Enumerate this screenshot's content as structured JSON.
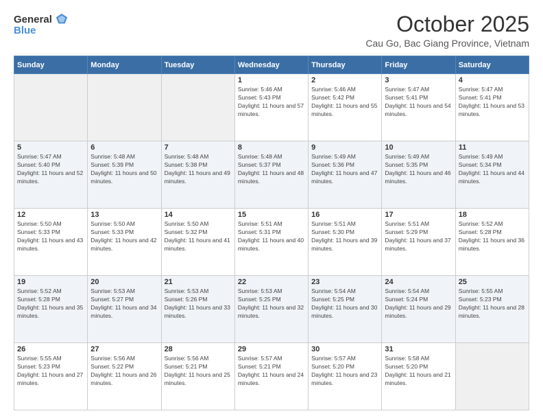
{
  "header": {
    "logo_general": "General",
    "logo_blue": "Blue",
    "month_title": "October 2025",
    "location": "Cau Go, Bac Giang Province, Vietnam"
  },
  "weekdays": [
    "Sunday",
    "Monday",
    "Tuesday",
    "Wednesday",
    "Thursday",
    "Friday",
    "Saturday"
  ],
  "weeks": [
    [
      {
        "day": "",
        "sunrise": "",
        "sunset": "",
        "daylight": ""
      },
      {
        "day": "",
        "sunrise": "",
        "sunset": "",
        "daylight": ""
      },
      {
        "day": "",
        "sunrise": "",
        "sunset": "",
        "daylight": ""
      },
      {
        "day": "1",
        "sunrise": "Sunrise: 5:46 AM",
        "sunset": "Sunset: 5:43 PM",
        "daylight": "Daylight: 11 hours and 57 minutes."
      },
      {
        "day": "2",
        "sunrise": "Sunrise: 5:46 AM",
        "sunset": "Sunset: 5:42 PM",
        "daylight": "Daylight: 11 hours and 55 minutes."
      },
      {
        "day": "3",
        "sunrise": "Sunrise: 5:47 AM",
        "sunset": "Sunset: 5:41 PM",
        "daylight": "Daylight: 11 hours and 54 minutes."
      },
      {
        "day": "4",
        "sunrise": "Sunrise: 5:47 AM",
        "sunset": "Sunset: 5:41 PM",
        "daylight": "Daylight: 11 hours and 53 minutes."
      }
    ],
    [
      {
        "day": "5",
        "sunrise": "Sunrise: 5:47 AM",
        "sunset": "Sunset: 5:40 PM",
        "daylight": "Daylight: 11 hours and 52 minutes."
      },
      {
        "day": "6",
        "sunrise": "Sunrise: 5:48 AM",
        "sunset": "Sunset: 5:39 PM",
        "daylight": "Daylight: 11 hours and 50 minutes."
      },
      {
        "day": "7",
        "sunrise": "Sunrise: 5:48 AM",
        "sunset": "Sunset: 5:38 PM",
        "daylight": "Daylight: 11 hours and 49 minutes."
      },
      {
        "day": "8",
        "sunrise": "Sunrise: 5:48 AM",
        "sunset": "Sunset: 5:37 PM",
        "daylight": "Daylight: 11 hours and 48 minutes."
      },
      {
        "day": "9",
        "sunrise": "Sunrise: 5:49 AM",
        "sunset": "Sunset: 5:36 PM",
        "daylight": "Daylight: 11 hours and 47 minutes."
      },
      {
        "day": "10",
        "sunrise": "Sunrise: 5:49 AM",
        "sunset": "Sunset: 5:35 PM",
        "daylight": "Daylight: 11 hours and 46 minutes."
      },
      {
        "day": "11",
        "sunrise": "Sunrise: 5:49 AM",
        "sunset": "Sunset: 5:34 PM",
        "daylight": "Daylight: 11 hours and 44 minutes."
      }
    ],
    [
      {
        "day": "12",
        "sunrise": "Sunrise: 5:50 AM",
        "sunset": "Sunset: 5:33 PM",
        "daylight": "Daylight: 11 hours and 43 minutes."
      },
      {
        "day": "13",
        "sunrise": "Sunrise: 5:50 AM",
        "sunset": "Sunset: 5:33 PM",
        "daylight": "Daylight: 11 hours and 42 minutes."
      },
      {
        "day": "14",
        "sunrise": "Sunrise: 5:50 AM",
        "sunset": "Sunset: 5:32 PM",
        "daylight": "Daylight: 11 hours and 41 minutes."
      },
      {
        "day": "15",
        "sunrise": "Sunrise: 5:51 AM",
        "sunset": "Sunset: 5:31 PM",
        "daylight": "Daylight: 11 hours and 40 minutes."
      },
      {
        "day": "16",
        "sunrise": "Sunrise: 5:51 AM",
        "sunset": "Sunset: 5:30 PM",
        "daylight": "Daylight: 11 hours and 39 minutes."
      },
      {
        "day": "17",
        "sunrise": "Sunrise: 5:51 AM",
        "sunset": "Sunset: 5:29 PM",
        "daylight": "Daylight: 11 hours and 37 minutes."
      },
      {
        "day": "18",
        "sunrise": "Sunrise: 5:52 AM",
        "sunset": "Sunset: 5:28 PM",
        "daylight": "Daylight: 11 hours and 36 minutes."
      }
    ],
    [
      {
        "day": "19",
        "sunrise": "Sunrise: 5:52 AM",
        "sunset": "Sunset: 5:28 PM",
        "daylight": "Daylight: 11 hours and 35 minutes."
      },
      {
        "day": "20",
        "sunrise": "Sunrise: 5:53 AM",
        "sunset": "Sunset: 5:27 PM",
        "daylight": "Daylight: 11 hours and 34 minutes."
      },
      {
        "day": "21",
        "sunrise": "Sunrise: 5:53 AM",
        "sunset": "Sunset: 5:26 PM",
        "daylight": "Daylight: 11 hours and 33 minutes."
      },
      {
        "day": "22",
        "sunrise": "Sunrise: 5:53 AM",
        "sunset": "Sunset: 5:25 PM",
        "daylight": "Daylight: 11 hours and 32 minutes."
      },
      {
        "day": "23",
        "sunrise": "Sunrise: 5:54 AM",
        "sunset": "Sunset: 5:25 PM",
        "daylight": "Daylight: 11 hours and 30 minutes."
      },
      {
        "day": "24",
        "sunrise": "Sunrise: 5:54 AM",
        "sunset": "Sunset: 5:24 PM",
        "daylight": "Daylight: 11 hours and 29 minutes."
      },
      {
        "day": "25",
        "sunrise": "Sunrise: 5:55 AM",
        "sunset": "Sunset: 5:23 PM",
        "daylight": "Daylight: 11 hours and 28 minutes."
      }
    ],
    [
      {
        "day": "26",
        "sunrise": "Sunrise: 5:55 AM",
        "sunset": "Sunset: 5:23 PM",
        "daylight": "Daylight: 11 hours and 27 minutes."
      },
      {
        "day": "27",
        "sunrise": "Sunrise: 5:56 AM",
        "sunset": "Sunset: 5:22 PM",
        "daylight": "Daylight: 11 hours and 26 minutes."
      },
      {
        "day": "28",
        "sunrise": "Sunrise: 5:56 AM",
        "sunset": "Sunset: 5:21 PM",
        "daylight": "Daylight: 11 hours and 25 minutes."
      },
      {
        "day": "29",
        "sunrise": "Sunrise: 5:57 AM",
        "sunset": "Sunset: 5:21 PM",
        "daylight": "Daylight: 11 hours and 24 minutes."
      },
      {
        "day": "30",
        "sunrise": "Sunrise: 5:57 AM",
        "sunset": "Sunset: 5:20 PM",
        "daylight": "Daylight: 11 hours and 23 minutes."
      },
      {
        "day": "31",
        "sunrise": "Sunrise: 5:58 AM",
        "sunset": "Sunset: 5:20 PM",
        "daylight": "Daylight: 11 hours and 21 minutes."
      },
      {
        "day": "",
        "sunrise": "",
        "sunset": "",
        "daylight": ""
      }
    ]
  ]
}
